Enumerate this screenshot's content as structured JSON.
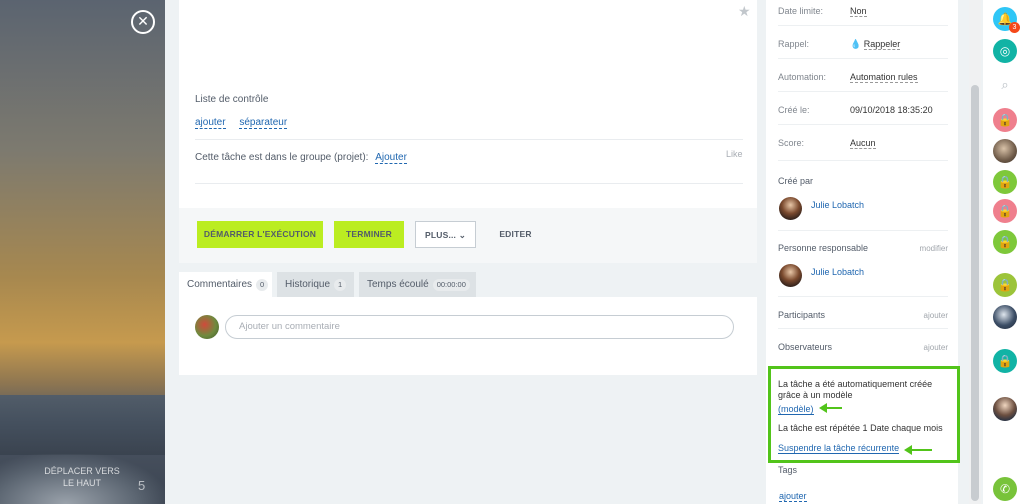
{
  "backdrop": {
    "close_icon": "close-icon",
    "move_up_label": "DÉPLACER VERS LE HAUT",
    "rating_glyph": "5"
  },
  "task": {
    "star_icon": "★",
    "checklist_title": "Liste de contrôle",
    "checklist_add": "ajouter",
    "checklist_separator": "séparateur",
    "group_text": "Cette tâche est dans le groupe (projet):",
    "group_add": "Ajouter",
    "like": "Like"
  },
  "actions": {
    "start": "DÉMARRER L'EXÉCUTION",
    "finish": "TERMINER",
    "more": "PLUS...",
    "edit": "EDITER"
  },
  "tabs": [
    {
      "label": "Commentaires",
      "count": "0"
    },
    {
      "label": "Historique",
      "count": "1"
    },
    {
      "label": "Temps écoulé",
      "count": "00:00:00"
    }
  ],
  "comment": {
    "placeholder": "Ajouter un commentaire"
  },
  "sidebar": {
    "deadline_label": "Date limite:",
    "deadline_value": "Non",
    "reminder_label": "Rappel:",
    "reminder_value": "Rappeler",
    "automation_label": "Automation:",
    "automation_value": "Automation rules",
    "created_label": "Créé le:",
    "created_value": "09/10/2018 18:35:20",
    "score_label": "Score:",
    "score_value": "Aucun",
    "created_by_label": "Créé par",
    "created_by_name": "Julie Lobatch",
    "responsible_label": "Personne responsable",
    "responsible_action": "modifier",
    "responsible_name": "Julie Lobatch",
    "participants_label": "Participants",
    "participants_action": "ajouter",
    "observers_label": "Observateurs",
    "observers_action": "ajouter",
    "auto_created_text": "La tâche a été automatiquement créée grâce à un modèle",
    "template_link": "(modèle)",
    "repeat_text": "La tâche est répétée 1 Date chaque mois",
    "suspend_link": "Suspendre la tâche récurrente",
    "tags_label": "Tags",
    "tags_add": "ajouter"
  },
  "iconbar": {
    "notifications_badge": "3"
  },
  "colors": {
    "accent_green": "#bbed21",
    "highlight": "#52c41a",
    "link": "#2067b0"
  }
}
